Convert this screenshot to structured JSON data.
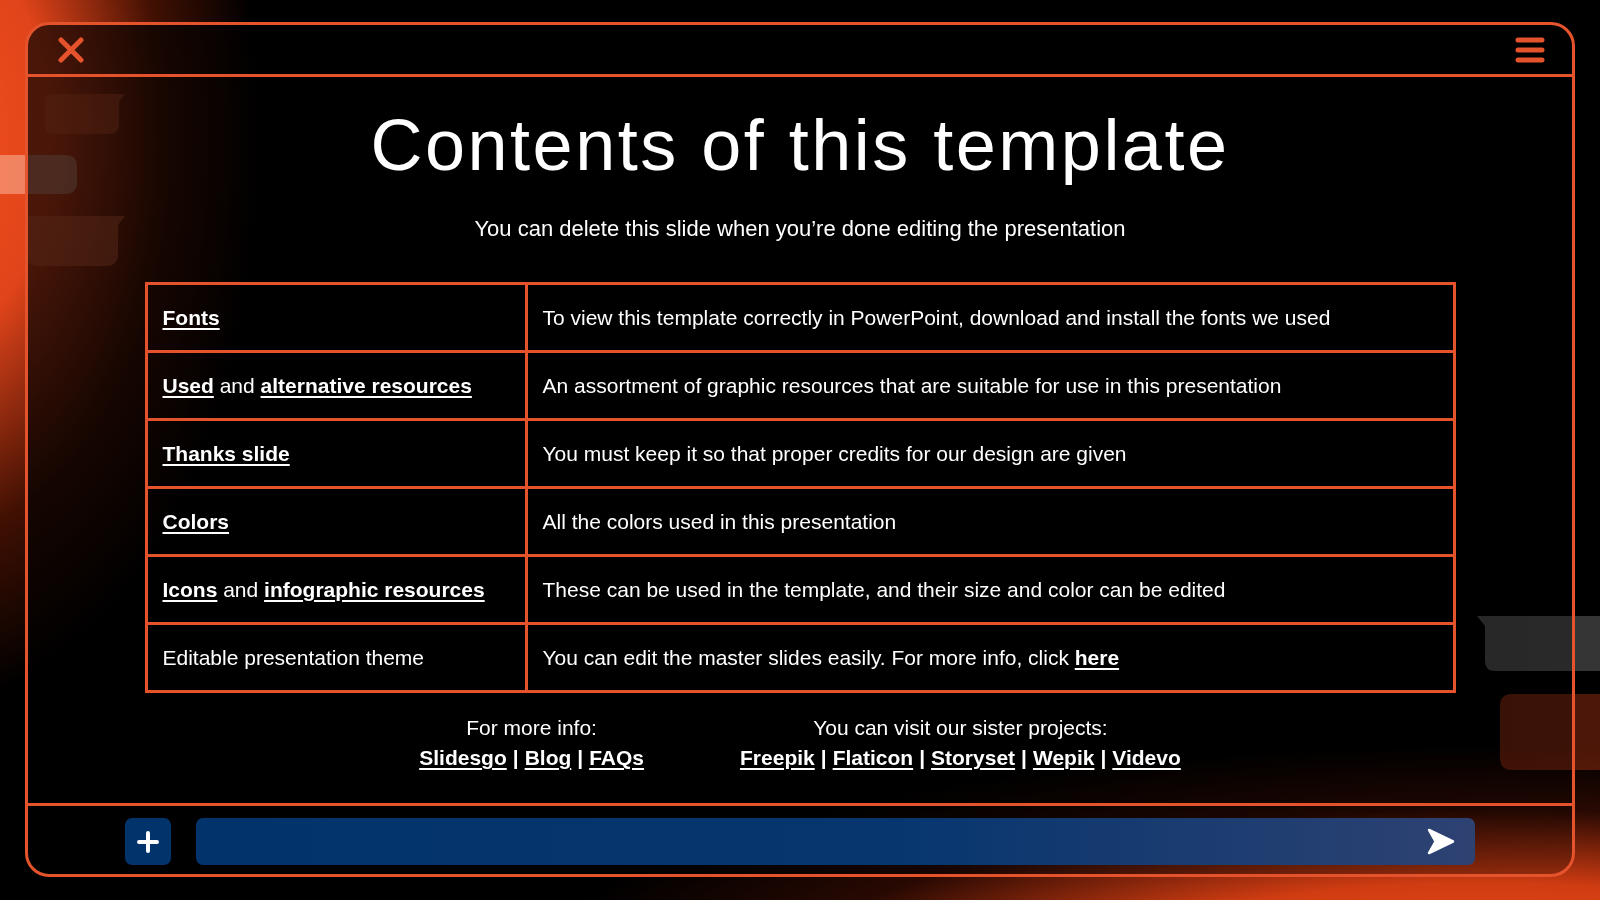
{
  "title": "Contents of this template",
  "subtitle": "You can delete this slide when you’re done editing the presentation",
  "table": {
    "rows": [
      {
        "topic": [
          {
            "kind": "link",
            "text": "Fonts"
          }
        ],
        "description": [
          {
            "kind": "text",
            "text": "To view this template correctly in PowerPoint, download and install the fonts we used"
          }
        ]
      },
      {
        "topic": [
          {
            "kind": "link",
            "text": "Used"
          },
          {
            "kind": "text",
            "text": " and "
          },
          {
            "kind": "link",
            "text": "alternative resources"
          }
        ],
        "description": [
          {
            "kind": "text",
            "text": "An assortment of graphic resources that are suitable for use in this presentation"
          }
        ]
      },
      {
        "topic": [
          {
            "kind": "link",
            "text": "Thanks slide"
          }
        ],
        "description": [
          {
            "kind": "text",
            "text": "You must keep it so that proper credits for our design are given"
          }
        ]
      },
      {
        "topic": [
          {
            "kind": "link",
            "text": "Colors"
          }
        ],
        "description": [
          {
            "kind": "text",
            "text": "All the colors used in this presentation"
          }
        ]
      },
      {
        "topic": [
          {
            "kind": "link",
            "text": "Icons"
          },
          {
            "kind": "text",
            "text": " and "
          },
          {
            "kind": "link",
            "text": "infographic resources"
          }
        ],
        "description": [
          {
            "kind": "text",
            "text": "These can be used in the template, and their size and color can be edited"
          }
        ]
      },
      {
        "topic": [
          {
            "kind": "text",
            "text": "Editable presentation theme"
          }
        ],
        "description": [
          {
            "kind": "text",
            "text": "You can edit the master slides easily. For more info, click "
          },
          {
            "kind": "link",
            "text": "here"
          }
        ]
      }
    ]
  },
  "footer": [
    {
      "label": "For more info:",
      "links": [
        {
          "kind": "link",
          "text": "Slidesgo"
        },
        {
          "kind": "separator",
          "text": "|"
        },
        {
          "kind": "link",
          "text": "Blog"
        },
        {
          "kind": "separator",
          "text": "|"
        },
        {
          "kind": "link",
          "text": "FAQs"
        }
      ]
    },
    {
      "label": "You can visit our sister projects:",
      "links": [
        {
          "kind": "link",
          "text": "Freepik"
        },
        {
          "kind": "separator",
          "text": "|"
        },
        {
          "kind": "link",
          "text": "Flaticon"
        },
        {
          "kind": "separator",
          "text": "|"
        },
        {
          "kind": "link",
          "text": "Storyset"
        },
        {
          "kind": "separator",
          "text": "|"
        },
        {
          "kind": "link",
          "text": "Wepik"
        },
        {
          "kind": "separator",
          "text": "|"
        },
        {
          "kind": "link",
          "text": "Videvo"
        }
      ]
    }
  ]
}
